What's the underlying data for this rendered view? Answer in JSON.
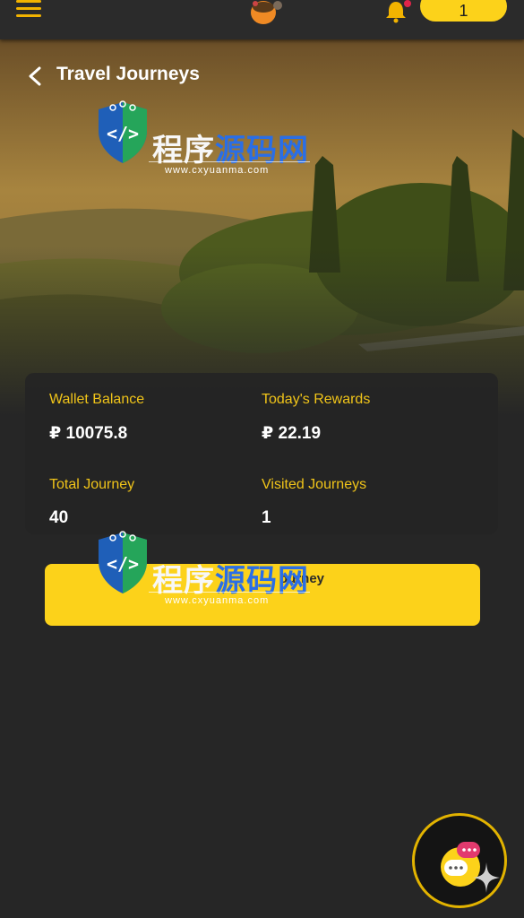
{
  "header": {
    "counter_value": "1"
  },
  "hero": {
    "title": "Travel Journeys"
  },
  "stats": {
    "wallet_balance_label": "Wallet Balance",
    "wallet_balance_value": "₽ 10075.8",
    "todays_rewards_label": "Today's Rewards",
    "todays_rewards_value": "₽ 22.19",
    "total_journey_label": "Total Journey",
    "total_journey_value": "40",
    "visited_journeys_label": "Visited Journeys",
    "visited_journeys_value": "1"
  },
  "start_button": {
    "label_visible": "ourney"
  },
  "watermark": {
    "text_part1": "程序",
    "text_part2": "源码网",
    "url": "www.cxyuanma.com"
  },
  "colors": {
    "accent": "#fcd21a",
    "label_gold": "#f0c419",
    "background": "#262626",
    "watermark_blue": "#2a6ee6"
  },
  "icons": [
    "menu-icon",
    "logo-icon",
    "bell-icon",
    "back-chevron-icon",
    "chat-bubbles-icon",
    "sparkle-icon"
  ]
}
